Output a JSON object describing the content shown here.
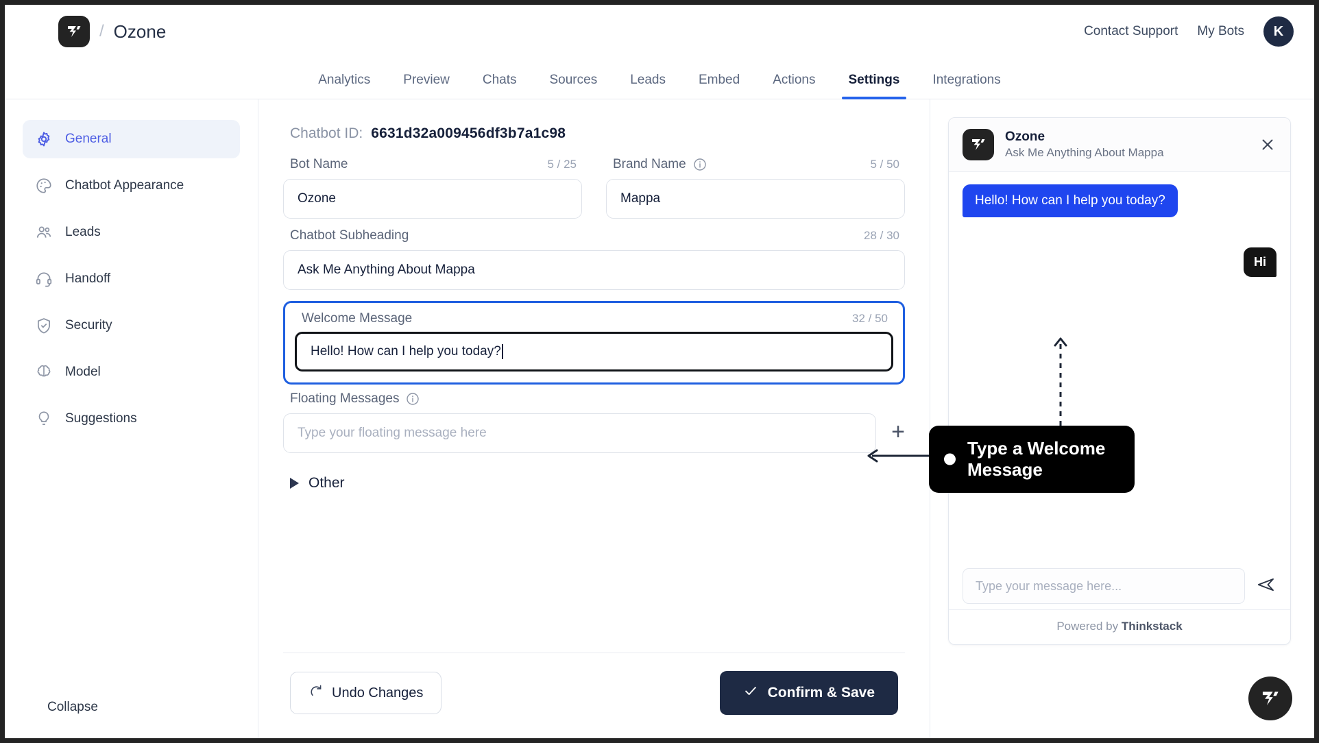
{
  "header": {
    "logo_icon": "thinkstack-logo-icon",
    "separator": "/",
    "bot_name": "Ozone",
    "contact_support": "Contact Support",
    "my_bots": "My Bots",
    "avatar_initial": "K"
  },
  "tabs": [
    {
      "label": "Analytics",
      "active": false
    },
    {
      "label": "Preview",
      "active": false
    },
    {
      "label": "Chats",
      "active": false
    },
    {
      "label": "Sources",
      "active": false
    },
    {
      "label": "Leads",
      "active": false
    },
    {
      "label": "Embed",
      "active": false
    },
    {
      "label": "Actions",
      "active": false
    },
    {
      "label": "Settings",
      "active": true
    },
    {
      "label": "Integrations",
      "active": false
    }
  ],
  "sidebar": {
    "items": [
      {
        "label": "General",
        "icon": "gear-icon",
        "active": true
      },
      {
        "label": "Chatbot Appearance",
        "icon": "palette-icon",
        "active": false
      },
      {
        "label": "Leads",
        "icon": "users-icon",
        "active": false
      },
      {
        "label": "Handoff",
        "icon": "headset-icon",
        "active": false
      },
      {
        "label": "Security",
        "icon": "shield-check-icon",
        "active": false
      },
      {
        "label": "Model",
        "icon": "brain-icon",
        "active": false
      },
      {
        "label": "Suggestions",
        "icon": "lightbulb-icon",
        "active": false
      }
    ],
    "collapse_label": "Collapse",
    "collapse_icon": "collapse-left-icon"
  },
  "form": {
    "chatbot_id_label": "Chatbot ID:",
    "chatbot_id_value": "6631d32a009456df3b7a1c98",
    "bot_name": {
      "label": "Bot Name",
      "counter": "5 / 25",
      "value": "Ozone"
    },
    "brand_name": {
      "label": "Brand Name",
      "counter": "5 / 50",
      "value": "Mappa",
      "info_icon": "info-icon"
    },
    "subheading": {
      "label": "Chatbot Subheading",
      "counter": "28 / 30",
      "value": "Ask Me Anything About Mappa"
    },
    "welcome": {
      "label": "Welcome Message",
      "counter": "32 / 50",
      "value": "Hello! How can I help you today?"
    },
    "floating": {
      "label": "Floating Messages",
      "info_icon": "info-icon",
      "placeholder": "Type your floating message here",
      "add_icon": "plus-icon"
    },
    "other_label": "Other",
    "other_icon": "triangle-right-icon",
    "undo_label": "Undo Changes",
    "undo_icon": "refresh-icon",
    "save_label": "Confirm & Save",
    "save_icon": "check-icon"
  },
  "preview": {
    "title": "Ozone",
    "subtitle": "Ask Me Anything About Mappa",
    "close_icon": "close-icon",
    "bot_message": "Hello! How can I help you today?",
    "user_message": "Hi",
    "input_placeholder": "Type your message here...",
    "send_icon": "send-icon",
    "powered_prefix": "Powered by ",
    "powered_brand": "Thinkstack",
    "launcher_icon": "thinkstack-logo-icon"
  },
  "callout": {
    "text": "Type a Welcome Message",
    "dot_icon": "bullet-dot-icon",
    "arrow_icon": "arrow-left-icon",
    "dashed_arrow_icon": "dashed-arrow-up-icon"
  },
  "colors": {
    "accent_blue": "#2563eb",
    "active_nav": "#4e5ee4",
    "bubble_blue": "#1f46ef",
    "dark": "#1e2a44",
    "logo_dark": "#232323"
  }
}
